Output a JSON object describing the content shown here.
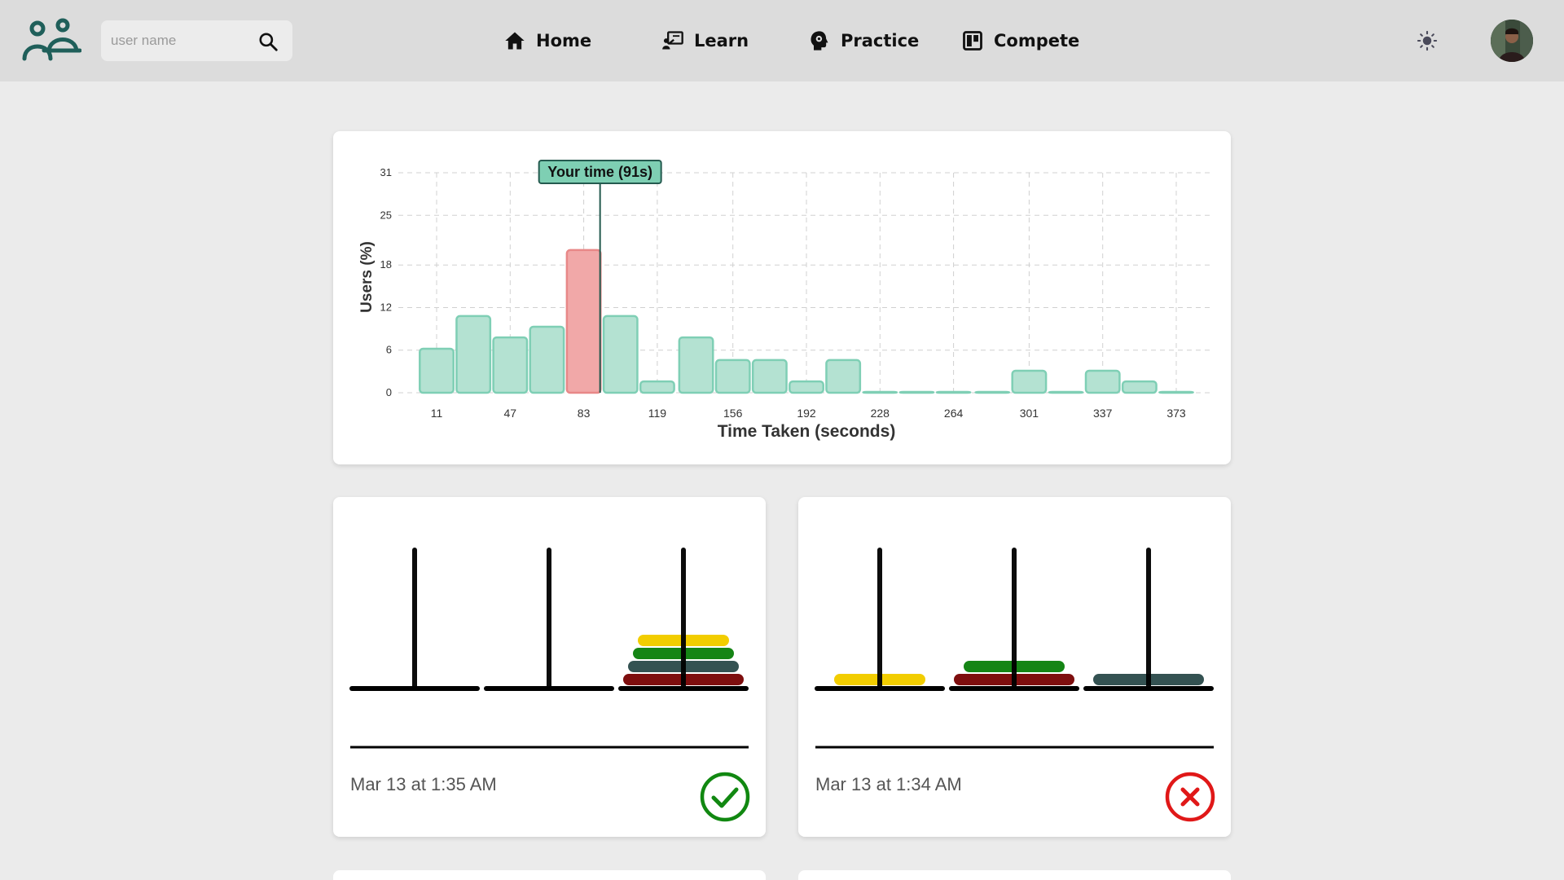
{
  "header": {
    "search": {
      "placeholder": "user name",
      "value": ""
    },
    "nav": [
      {
        "label": "Home",
        "icon": "home-icon"
      },
      {
        "label": "Learn",
        "icon": "learn-icon"
      },
      {
        "label": "Practice",
        "icon": "practice-icon"
      },
      {
        "label": "Compete",
        "icon": "compete-icon"
      }
    ],
    "logo_icon": "people-logo-icon",
    "theme_icon": "sun-icon",
    "avatar_icon": "avatar"
  },
  "chart_data": {
    "type": "bar",
    "xlabel": "Time Taken (seconds)",
    "ylabel": "Users (%)",
    "ylim": [
      0,
      31
    ],
    "y_ticks": [
      0,
      6,
      12,
      18,
      25,
      31
    ],
    "x_tick_labels": [
      "11",
      "47",
      "83",
      "119",
      "156",
      "192",
      "228",
      "264",
      "301",
      "337",
      "373"
    ],
    "x_range": [
      11,
      373
    ],
    "bin_width": 18.1,
    "bins": [
      11,
      29,
      47,
      65,
      83,
      101,
      119,
      138,
      156,
      174,
      192,
      210,
      228,
      246,
      264,
      283,
      301,
      319,
      337,
      355,
      373
    ],
    "values": [
      6.2,
      10.8,
      7.8,
      9.3,
      20.1,
      10.8,
      1.6,
      7.8,
      4.6,
      4.6,
      1.6,
      4.6,
      0,
      0,
      0,
      0,
      3.1,
      0,
      3.1,
      1.6,
      0
    ],
    "highlight_index": 4,
    "marker": {
      "label": "Your time (91s)",
      "value": 91
    },
    "grid": true,
    "colors": {
      "bar": "#b4e2d2",
      "bar_stroke": "#7fcfb5",
      "highlight": "#f1a8a8",
      "highlight_stroke": "#e88888",
      "marker_fill": "#7ecfb3",
      "marker_line": "#245a4f"
    }
  },
  "attempts": [
    {
      "date": "Mar 13 at 1:35 AM",
      "status": "success",
      "status_icon": "check-circle-icon",
      "pegs": [
        [],
        [],
        [
          "darkred",
          "slate",
          "green",
          "gold"
        ]
      ]
    },
    {
      "date": "Mar 13 at 1:34 AM",
      "status": "failure",
      "status_icon": "x-circle-icon",
      "pegs": [
        [
          "gold"
        ],
        [
          "darkred",
          "green"
        ],
        [
          "slate"
        ]
      ]
    }
  ],
  "disk_colors": {
    "gold": "#f2cd00",
    "green": "#158515",
    "slate": "#345252",
    "darkred": "#7e0e0e"
  },
  "status_colors": {
    "success": "#118811",
    "failure": "#e01818"
  }
}
